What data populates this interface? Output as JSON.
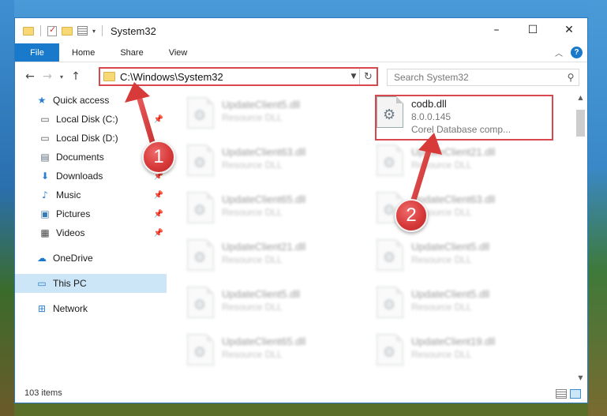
{
  "window": {
    "title": "System32",
    "controls": {
      "minimize": "–",
      "maximize": "☐",
      "close": "✕"
    }
  },
  "ribbon": {
    "tabs": [
      "File",
      "Home",
      "Share",
      "View"
    ],
    "help": "?"
  },
  "navbar": {
    "address": "C:\\Windows\\System32",
    "search_placeholder": "Search System32"
  },
  "sidebar": {
    "quick_access": "Quick access",
    "quick_items": [
      {
        "label": "Local Disk (C:)",
        "icon": "drive-icon",
        "pinned": true
      },
      {
        "label": "Local Disk (D:)",
        "icon": "drive-icon",
        "pinned": false
      },
      {
        "label": "Documents",
        "icon": "documents-icon",
        "pinned": true
      },
      {
        "label": "Downloads",
        "icon": "downloads-icon",
        "pinned": true
      },
      {
        "label": "Music",
        "icon": "music-icon",
        "pinned": true
      },
      {
        "label": "Pictures",
        "icon": "pictures-icon",
        "pinned": true
      },
      {
        "label": "Videos",
        "icon": "videos-icon",
        "pinned": true
      }
    ],
    "onedrive": "OneDrive",
    "this_pc": "This PC",
    "network": "Network"
  },
  "files": {
    "highlighted": {
      "name": "codb.dll",
      "version": "8.0.0.145",
      "description": "Corel Database comp..."
    },
    "left_column": [
      {
        "name": "UpdateClient5.dll",
        "type": "Resource DLL"
      },
      {
        "name": "UpdateClient63.dll",
        "type": "Resource DLL"
      },
      {
        "name": "UpdateClient65.dll",
        "type": "Resource DLL"
      },
      {
        "name": "UpdateClient21.dll",
        "type": "Resource DLL"
      },
      {
        "name": "UpdateClient5.dll",
        "type": "Resource DLL"
      },
      {
        "name": "UpdateClient65.dll",
        "type": "Resource DLL"
      }
    ],
    "right_column": [
      {
        "name": "UpdateClient21.dll",
        "type": "Resource DLL"
      },
      {
        "name": "UpdateClient63.dll",
        "type": "Resource DLL"
      },
      {
        "name": "UpdateClient5.dll",
        "type": "Resource DLL"
      },
      {
        "name": "UpdateClient5.dll",
        "type": "Resource DLL"
      },
      {
        "name": "UpdateClient19.dll",
        "type": "Resource DLL"
      }
    ]
  },
  "status": {
    "item_count": "103 items"
  },
  "annotations": {
    "badge1": "1",
    "badge2": "2"
  },
  "colors": {
    "accent": "#1979ca",
    "highlight_border": "#d9474f",
    "selection": "#cce6f7"
  }
}
